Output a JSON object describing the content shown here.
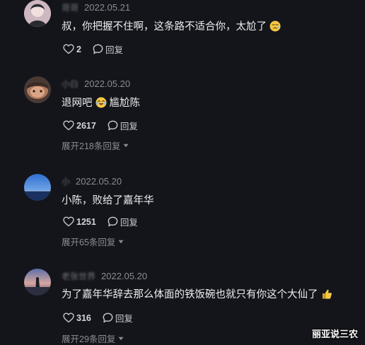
{
  "comments": [
    {
      "username": "哥哥",
      "date": "2022.05.21",
      "text": "叔，你把握不住啊，这条路不适合你，太尬了",
      "likes": "2",
      "reply_label": "回复"
    },
    {
      "username": "小白",
      "date": "2022.05.20",
      "text_before": "退网吧",
      "text_after": "尴尬陈",
      "likes": "2617",
      "reply_label": "回复",
      "expand_label": "展开218条回复"
    },
    {
      "username": "小",
      "date": "2022.05.20",
      "text": "小陈，败给了嘉年华",
      "likes": "1251",
      "reply_label": "回复",
      "expand_label": "展开65条回复"
    },
    {
      "username": "老张世界",
      "date": "2022.05.20",
      "text": "为了嘉年华辞去那么体面的铁饭碗也就只有你这个大仙了",
      "likes": "316",
      "reply_label": "回复",
      "expand_label": "展开29条回复"
    }
  ],
  "watermark": "丽亚说三农",
  "icons": {
    "like": "heart-outline-icon",
    "reply": "speech-bubble-icon",
    "expand": "caret-down-icon"
  },
  "colors": {
    "background": "#14151a",
    "text": "#eceef2",
    "secondary": "#8a8c94"
  }
}
